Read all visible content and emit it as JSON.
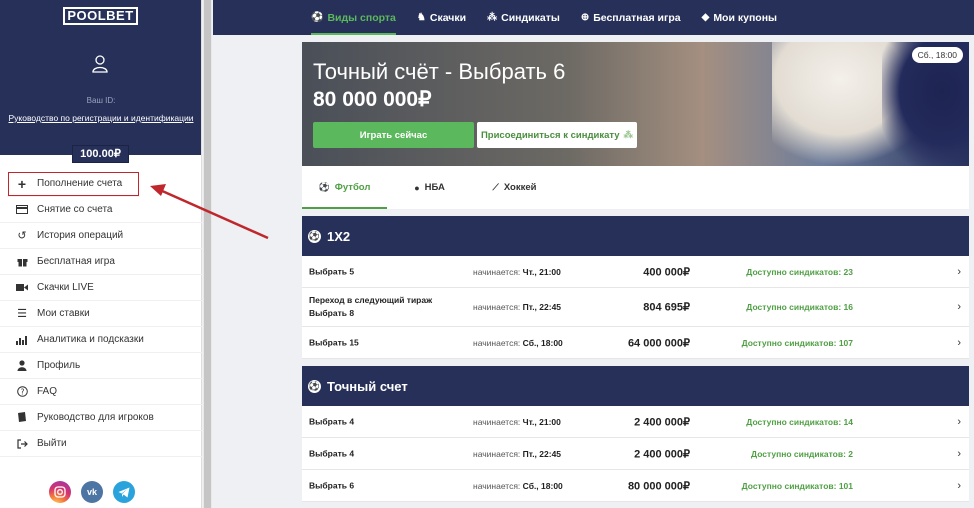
{
  "sidebar": {
    "logo": "POOLBET",
    "your_id_label": "Ваш ID:",
    "guide_link": "Руководство по регистрации и идентификации",
    "balance": "100.00₽",
    "menu": [
      {
        "label": "Пополнение счета",
        "icon": "plus-icon"
      },
      {
        "label": "Снятие со счета",
        "icon": "card-icon"
      },
      {
        "label": "История операций",
        "icon": "history-icon"
      },
      {
        "label": "Бесплатная игра",
        "icon": "gift-icon"
      },
      {
        "label": "Скачки LIVE",
        "icon": "video-icon"
      },
      {
        "label": "Мои ставки",
        "icon": "list-icon"
      },
      {
        "label": "Аналитика и подсказки",
        "icon": "chart-icon"
      },
      {
        "label": "Профиль",
        "icon": "user-icon"
      },
      {
        "label": "FAQ",
        "icon": "question-icon"
      },
      {
        "label": "Руководство для игроков",
        "icon": "book-icon"
      },
      {
        "label": "Выйти",
        "icon": "logout-icon"
      }
    ],
    "socials": [
      {
        "name": "instagram-icon"
      },
      {
        "name": "vk-icon",
        "text": "vk"
      },
      {
        "name": "telegram-icon"
      }
    ]
  },
  "topnav": {
    "tabs": [
      {
        "label": "Виды спорта",
        "icon": "soccer-icon",
        "active": true
      },
      {
        "label": "Скачки",
        "icon": "horse-icon"
      },
      {
        "label": "Синдикаты",
        "icon": "group-icon"
      },
      {
        "label": "Бесплатная игра",
        "icon": "free-icon"
      },
      {
        "label": "Мои купоны",
        "icon": "ticket-icon"
      }
    ]
  },
  "banner": {
    "title": "Точный счёт - Выбрать 6",
    "amount": "80 000 000₽",
    "play_button": "Играть сейчас",
    "join_button": "Присоединиться к синдикату",
    "time_badge": "Сб., 18:00"
  },
  "sport_tabs": [
    {
      "label": "Футбол",
      "icon": "soccer-icon",
      "active": true
    },
    {
      "label": "НБА",
      "icon": "basketball-icon"
    },
    {
      "label": "Хоккей",
      "icon": "hockey-icon"
    }
  ],
  "sections": [
    {
      "title": "1X2",
      "rows": [
        {
          "name": "Выбрать 5",
          "start_label": "начинается:",
          "start": "Чт., 21:00",
          "amount": "400 000₽",
          "available": "Доступно синдикатов: 23"
        },
        {
          "name": "Переход в следующий тираж\nВыбрать 8",
          "start_label": "начинается:",
          "start": "Пт., 22:45",
          "amount": "804 695₽",
          "available": "Доступно синдикатов: 16"
        },
        {
          "name": "Выбрать 15",
          "start_label": "начинается:",
          "start": "Сб., 18:00",
          "amount": "64 000 000₽",
          "available": "Доступно синдикатов: 107"
        }
      ]
    },
    {
      "title": "Точный счет",
      "rows": [
        {
          "name": "Выбрать 4",
          "start_label": "начинается:",
          "start": "Чт., 21:00",
          "amount": "2 400 000₽",
          "available": "Доступно синдикатов: 14"
        },
        {
          "name": "Выбрать 4",
          "start_label": "начинается:",
          "start": "Пт., 22:45",
          "amount": "2 400 000₽",
          "available": "Доступно синдикатов: 2"
        },
        {
          "name": "Выбрать 6",
          "start_label": "начинается:",
          "start": "Сб., 18:00",
          "amount": "80 000 000₽",
          "available": "Доступно синдикатов: 101"
        }
      ]
    }
  ],
  "colors": {
    "navy": "#263059",
    "green": "#5cb85c",
    "annotation_red": "#c0272d"
  }
}
